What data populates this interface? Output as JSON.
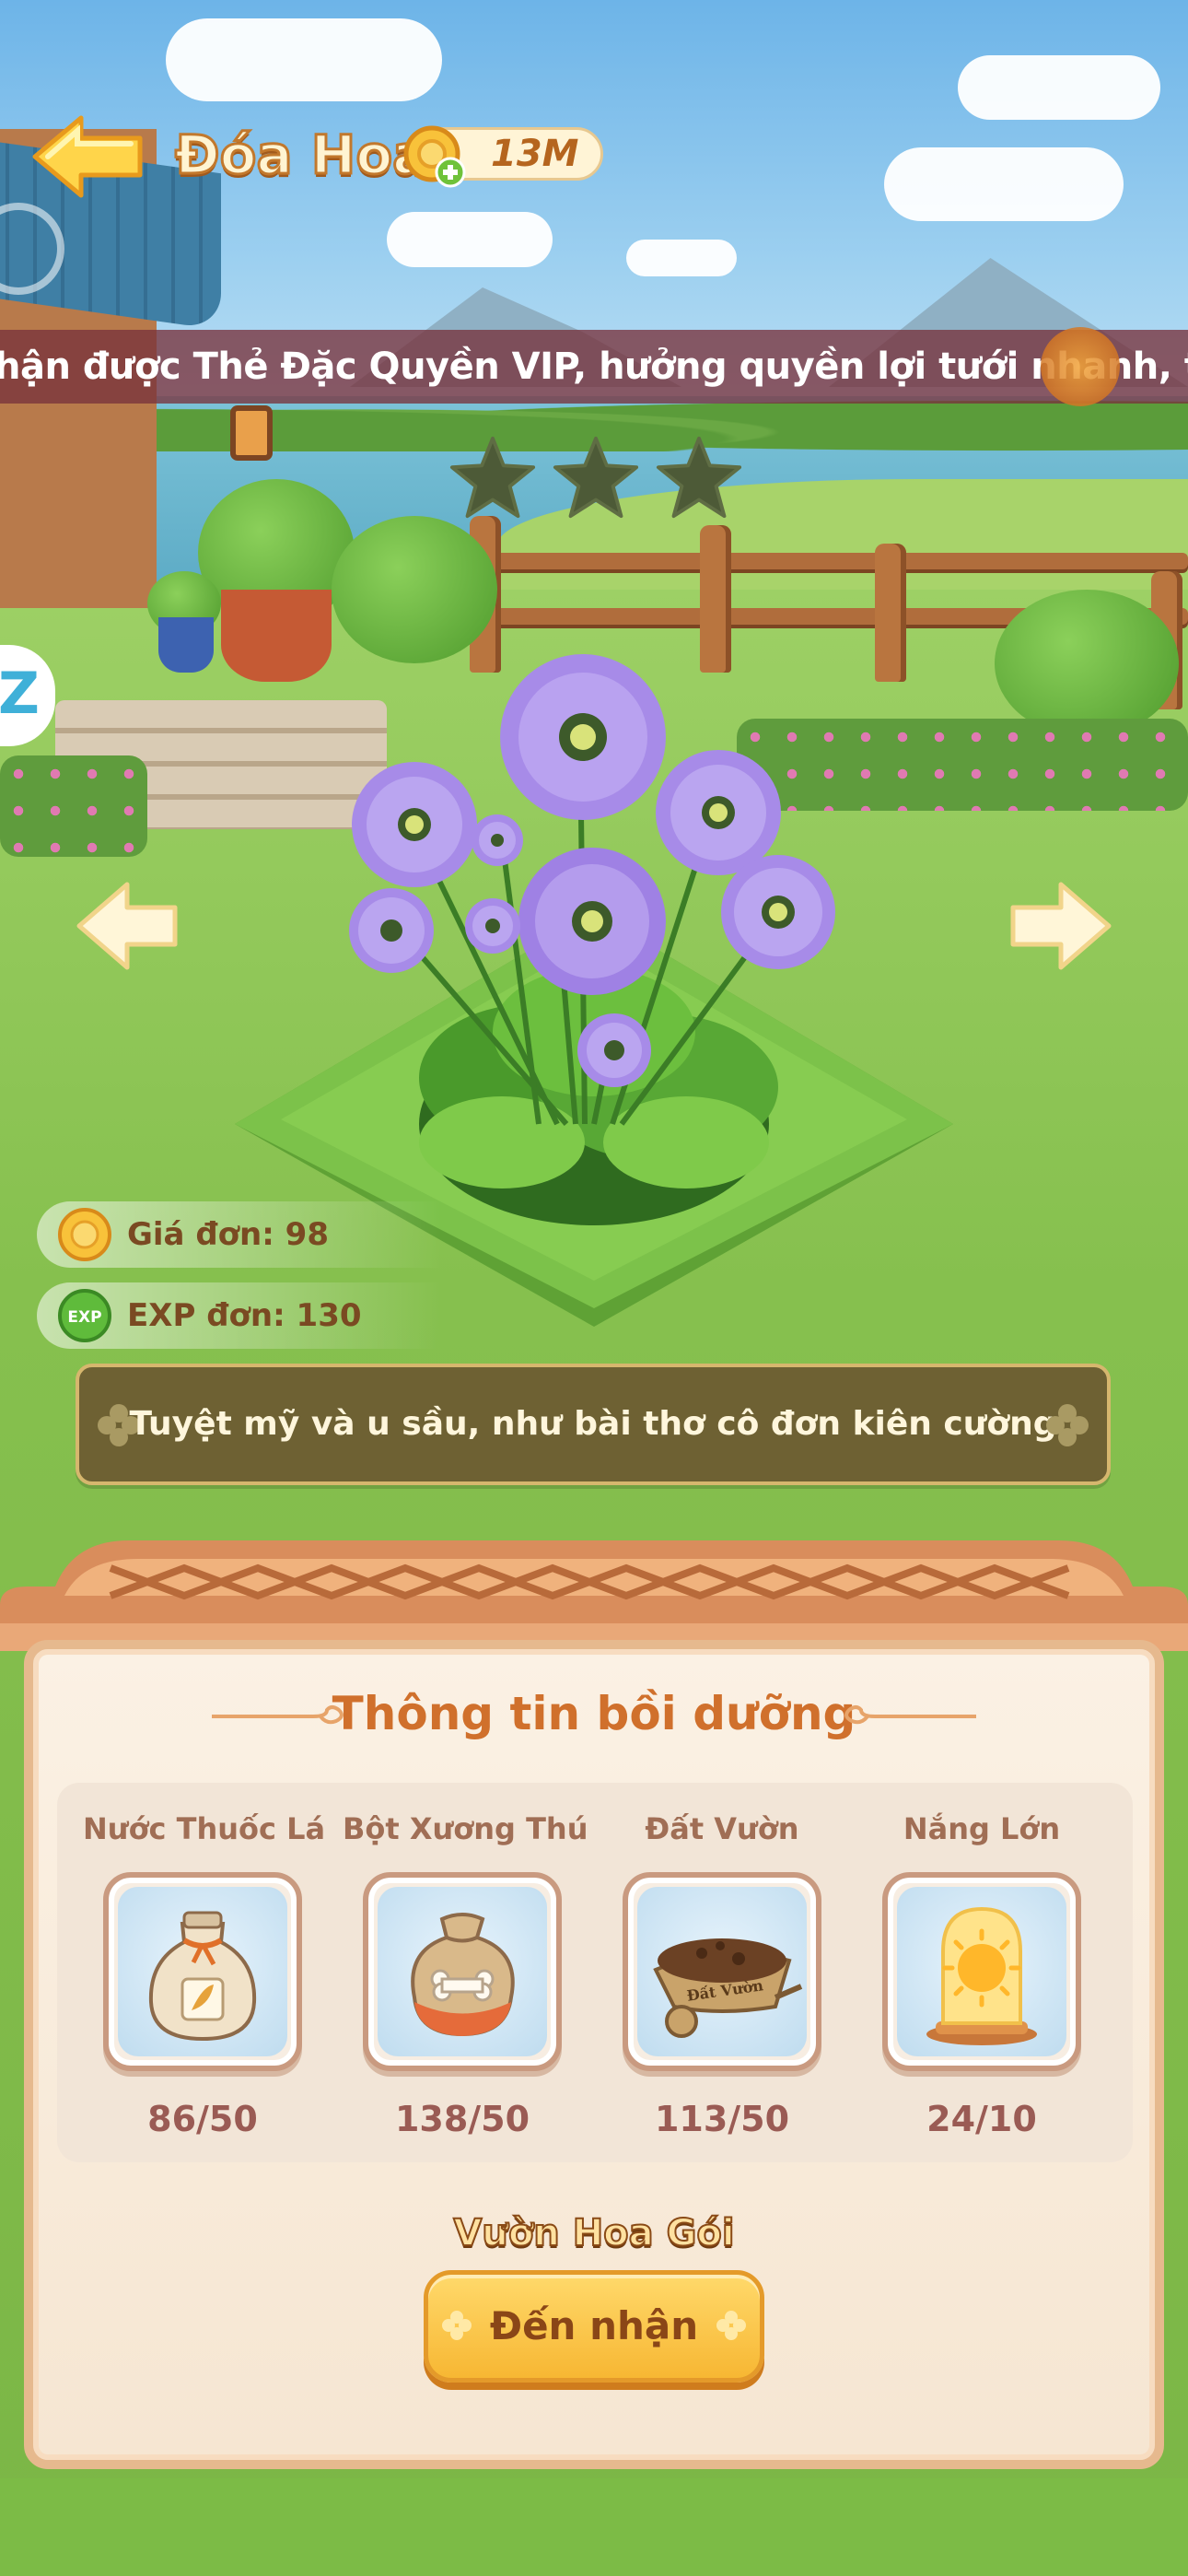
{
  "header": {
    "title": "Đóa Hoa",
    "currency_value": "13M"
  },
  "marquee": {
    "text": "hận được Thẻ Đặc Quyền VIP, hưởng quyền lợi tưới nhanh, thu ho"
  },
  "flower": {
    "stars_total": 3,
    "stars_filled": 0,
    "price_label": "Giá đơn: 98",
    "exp_label": "EXP đơn: 130",
    "exp_badge": "EXP",
    "description": "Tuyệt mỹ và u sầu, như bài thơ cô đơn kiên cường"
  },
  "panel": {
    "title": "Thông tin bồi dưỡng",
    "items": [
      {
        "name": "Nước Thuốc Lá",
        "count": "86/50",
        "icon": "medicine-bottle-icon"
      },
      {
        "name": "Bột Xương Thú",
        "count": "138/50",
        "icon": "bone-powder-sack-icon"
      },
      {
        "name": "Đất Vườn",
        "count": "113/50",
        "icon": "soil-wheelbarrow-icon",
        "icon_text": "Đất Vườn"
      },
      {
        "name": "Nắng Lớn",
        "count": "24/10",
        "icon": "sun-jar-icon"
      }
    ],
    "pack_title": "Vườn Hoa Gói",
    "claim_label": "Đến nhận"
  },
  "colors": {
    "title_orange": "#d0702c",
    "claim_button": "#f7b733",
    "marquee_bg": "#78323c",
    "flower_petal": "#a78be8"
  }
}
